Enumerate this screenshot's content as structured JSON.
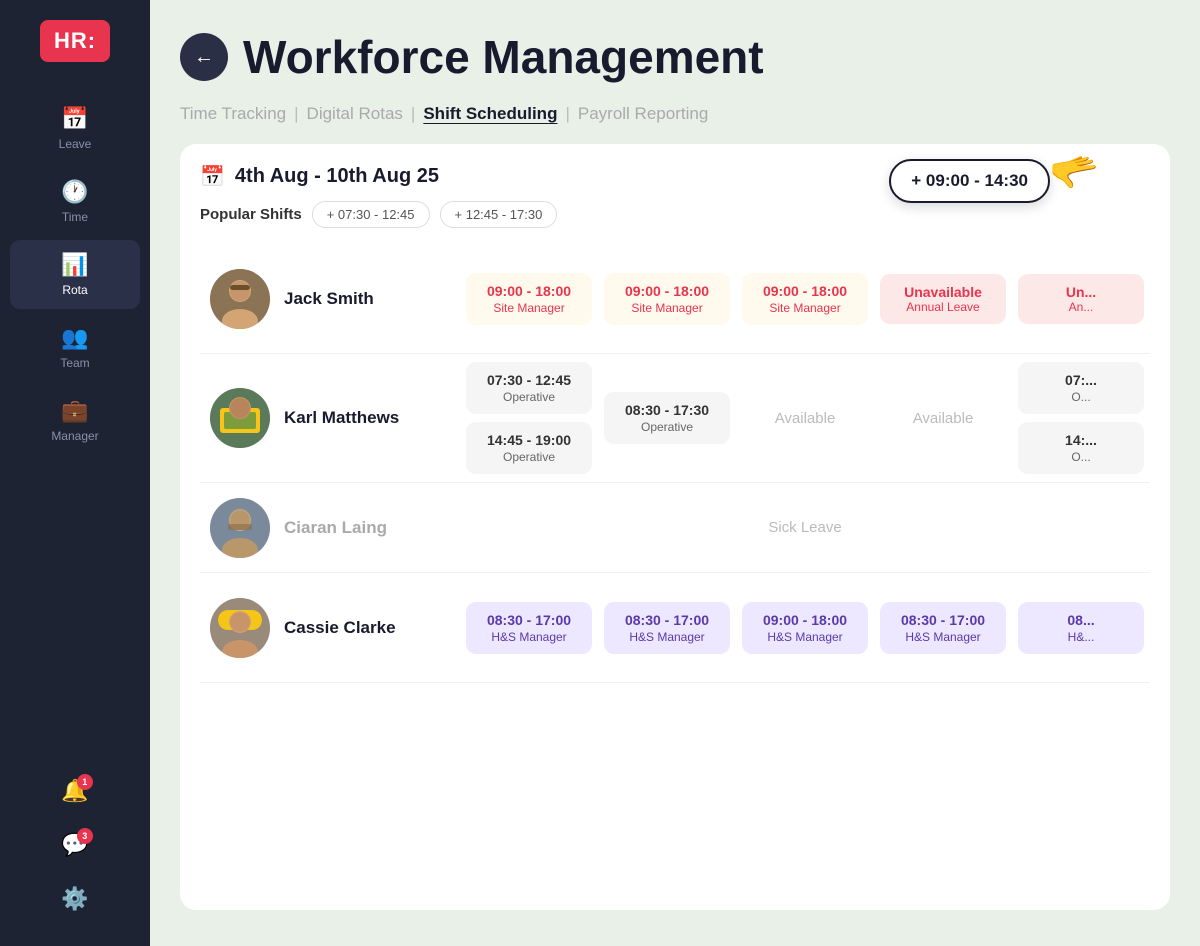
{
  "sidebar": {
    "logo": "HR:",
    "items": [
      {
        "id": "leave",
        "icon": "📅",
        "label": "Leave",
        "active": false
      },
      {
        "id": "time",
        "icon": "🕐",
        "label": "Time",
        "active": false
      },
      {
        "id": "rota",
        "icon": "📊",
        "label": "Rota",
        "active": true
      },
      {
        "id": "team",
        "icon": "👥",
        "label": "Team",
        "active": false
      },
      {
        "id": "manager",
        "icon": "💼",
        "label": "Manager",
        "active": false
      }
    ],
    "bottom_items": [
      {
        "id": "notifications",
        "icon": "🔔",
        "label": "",
        "badge": "1"
      },
      {
        "id": "messages",
        "icon": "💬",
        "label": "",
        "badge": "3"
      },
      {
        "id": "settings",
        "icon": "⚙️",
        "label": ""
      }
    ]
  },
  "header": {
    "back_label": "←",
    "title": "Workforce Management"
  },
  "nav_tabs": [
    {
      "id": "time-tracking",
      "label": "Time Tracking",
      "active": false
    },
    {
      "id": "digital-rotas",
      "label": "Digital Rotas",
      "active": false
    },
    {
      "id": "shift-scheduling",
      "label": "Shift Scheduling",
      "active": true
    },
    {
      "id": "payroll-reporting",
      "label": "Payroll Reporting",
      "active": false
    }
  ],
  "schedule": {
    "date_range": "4th Aug - 10th Aug 25",
    "popular_shifts_label": "Popular Shifts",
    "shift_pills": [
      {
        "label": "+ 07:30 - 12:45"
      },
      {
        "label": "+ 12:45 - 17:30"
      }
    ],
    "floating_shift": "+ 09:00 - 14:30",
    "employees": [
      {
        "id": "jack-smith",
        "name": "Jack Smith",
        "avatar_class": "jack",
        "avatar_emoji": "👨",
        "shifts": [
          {
            "type": "yellow",
            "time": "09:00 - 18:00",
            "role": "Site Manager"
          },
          {
            "type": "yellow",
            "time": "09:00 - 18:00",
            "role": "Site Manager"
          },
          {
            "type": "yellow",
            "time": "09:00 - 18:00",
            "role": "Site Manager"
          },
          {
            "type": "unavailable",
            "time": "Unavailable",
            "sub": "Annual Leave"
          },
          {
            "type": "unavailable",
            "time": "Un...",
            "sub": "An..."
          }
        ]
      },
      {
        "id": "karl-matthews",
        "name": "Karl Matthews",
        "avatar_class": "karl",
        "avatar_emoji": "👷",
        "shifts": [
          {
            "type": "two-gray",
            "time1": "07:30 - 12:45",
            "role1": "Operative",
            "time2": "14:45 - 19:00",
            "role2": "Operative"
          },
          {
            "type": "gray",
            "time": "08:30 - 17:30",
            "role": "Operative"
          },
          {
            "type": "available",
            "label": "Available"
          },
          {
            "type": "available",
            "label": "Available"
          },
          {
            "type": "two-gray",
            "time1": "07:...",
            "role1": "O...",
            "time2": "14:...",
            "role2": "O..."
          }
        ]
      },
      {
        "id": "ciaran-laing",
        "name": "Ciaran Laing",
        "avatar_class": "ciaran",
        "avatar_emoji": "🧔",
        "muted": true,
        "shifts": [
          {
            "type": "empty"
          },
          {
            "type": "empty"
          },
          {
            "type": "sick",
            "label": "Sick Leave"
          },
          {
            "type": "empty"
          },
          {
            "type": "empty"
          }
        ]
      },
      {
        "id": "cassie-clarke",
        "name": "Cassie Clarke",
        "avatar_class": "cassie",
        "avatar_emoji": "👷‍♀️",
        "shifts": [
          {
            "type": "purple",
            "time": "08:30 - 17:00",
            "role": "H&S Manager"
          },
          {
            "type": "purple",
            "time": "08:30 - 17:00",
            "role": "H&S Manager"
          },
          {
            "type": "purple",
            "time": "09:00 - 18:00",
            "role": "H&S Manager"
          },
          {
            "type": "purple",
            "time": "08:30 - 17:00",
            "role": "H&S Manager"
          },
          {
            "type": "purple-partial",
            "time": "08...",
            "role": "H&..."
          }
        ]
      }
    ]
  }
}
